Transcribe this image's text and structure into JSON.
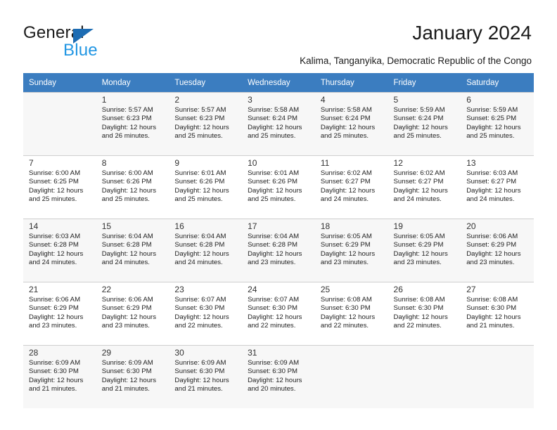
{
  "brand": {
    "name_dark": "General",
    "name_light": "Blue",
    "triangle_color": "#1d6cb3",
    "blue_color": "#2196e3"
  },
  "header": {
    "title": "January 2024",
    "subtitle": "Kalima, Tanganyika, Democratic Republic of the Congo"
  },
  "theme": {
    "header_bg": "#3b7dc0",
    "header_text": "#ffffff",
    "row_shade": "#f7f7f7",
    "grid_line": "#cfcfcf"
  },
  "calendar": {
    "weekday_headers": [
      "Sunday",
      "Monday",
      "Tuesday",
      "Wednesday",
      "Thursday",
      "Friday",
      "Saturday"
    ],
    "weeks": [
      [
        {
          "day": "",
          "sunrise": "",
          "sunset": "",
          "daylight_1": "",
          "daylight_2": ""
        },
        {
          "day": "1",
          "sunrise": "Sunrise: 5:57 AM",
          "sunset": "Sunset: 6:23 PM",
          "daylight_1": "Daylight: 12 hours",
          "daylight_2": "and 26 minutes."
        },
        {
          "day": "2",
          "sunrise": "Sunrise: 5:57 AM",
          "sunset": "Sunset: 6:23 PM",
          "daylight_1": "Daylight: 12 hours",
          "daylight_2": "and 25 minutes."
        },
        {
          "day": "3",
          "sunrise": "Sunrise: 5:58 AM",
          "sunset": "Sunset: 6:24 PM",
          "daylight_1": "Daylight: 12 hours",
          "daylight_2": "and 25 minutes."
        },
        {
          "day": "4",
          "sunrise": "Sunrise: 5:58 AM",
          "sunset": "Sunset: 6:24 PM",
          "daylight_1": "Daylight: 12 hours",
          "daylight_2": "and 25 minutes."
        },
        {
          "day": "5",
          "sunrise": "Sunrise: 5:59 AM",
          "sunset": "Sunset: 6:24 PM",
          "daylight_1": "Daylight: 12 hours",
          "daylight_2": "and 25 minutes."
        },
        {
          "day": "6",
          "sunrise": "Sunrise: 5:59 AM",
          "sunset": "Sunset: 6:25 PM",
          "daylight_1": "Daylight: 12 hours",
          "daylight_2": "and 25 minutes."
        }
      ],
      [
        {
          "day": "7",
          "sunrise": "Sunrise: 6:00 AM",
          "sunset": "Sunset: 6:25 PM",
          "daylight_1": "Daylight: 12 hours",
          "daylight_2": "and 25 minutes."
        },
        {
          "day": "8",
          "sunrise": "Sunrise: 6:00 AM",
          "sunset": "Sunset: 6:26 PM",
          "daylight_1": "Daylight: 12 hours",
          "daylight_2": "and 25 minutes."
        },
        {
          "day": "9",
          "sunrise": "Sunrise: 6:01 AM",
          "sunset": "Sunset: 6:26 PM",
          "daylight_1": "Daylight: 12 hours",
          "daylight_2": "and 25 minutes."
        },
        {
          "day": "10",
          "sunrise": "Sunrise: 6:01 AM",
          "sunset": "Sunset: 6:26 PM",
          "daylight_1": "Daylight: 12 hours",
          "daylight_2": "and 25 minutes."
        },
        {
          "day": "11",
          "sunrise": "Sunrise: 6:02 AM",
          "sunset": "Sunset: 6:27 PM",
          "daylight_1": "Daylight: 12 hours",
          "daylight_2": "and 24 minutes."
        },
        {
          "day": "12",
          "sunrise": "Sunrise: 6:02 AM",
          "sunset": "Sunset: 6:27 PM",
          "daylight_1": "Daylight: 12 hours",
          "daylight_2": "and 24 minutes."
        },
        {
          "day": "13",
          "sunrise": "Sunrise: 6:03 AM",
          "sunset": "Sunset: 6:27 PM",
          "daylight_1": "Daylight: 12 hours",
          "daylight_2": "and 24 minutes."
        }
      ],
      [
        {
          "day": "14",
          "sunrise": "Sunrise: 6:03 AM",
          "sunset": "Sunset: 6:28 PM",
          "daylight_1": "Daylight: 12 hours",
          "daylight_2": "and 24 minutes."
        },
        {
          "day": "15",
          "sunrise": "Sunrise: 6:04 AM",
          "sunset": "Sunset: 6:28 PM",
          "daylight_1": "Daylight: 12 hours",
          "daylight_2": "and 24 minutes."
        },
        {
          "day": "16",
          "sunrise": "Sunrise: 6:04 AM",
          "sunset": "Sunset: 6:28 PM",
          "daylight_1": "Daylight: 12 hours",
          "daylight_2": "and 24 minutes."
        },
        {
          "day": "17",
          "sunrise": "Sunrise: 6:04 AM",
          "sunset": "Sunset: 6:28 PM",
          "daylight_1": "Daylight: 12 hours",
          "daylight_2": "and 23 minutes."
        },
        {
          "day": "18",
          "sunrise": "Sunrise: 6:05 AM",
          "sunset": "Sunset: 6:29 PM",
          "daylight_1": "Daylight: 12 hours",
          "daylight_2": "and 23 minutes."
        },
        {
          "day": "19",
          "sunrise": "Sunrise: 6:05 AM",
          "sunset": "Sunset: 6:29 PM",
          "daylight_1": "Daylight: 12 hours",
          "daylight_2": "and 23 minutes."
        },
        {
          "day": "20",
          "sunrise": "Sunrise: 6:06 AM",
          "sunset": "Sunset: 6:29 PM",
          "daylight_1": "Daylight: 12 hours",
          "daylight_2": "and 23 minutes."
        }
      ],
      [
        {
          "day": "21",
          "sunrise": "Sunrise: 6:06 AM",
          "sunset": "Sunset: 6:29 PM",
          "daylight_1": "Daylight: 12 hours",
          "daylight_2": "and 23 minutes."
        },
        {
          "day": "22",
          "sunrise": "Sunrise: 6:06 AM",
          "sunset": "Sunset: 6:29 PM",
          "daylight_1": "Daylight: 12 hours",
          "daylight_2": "and 23 minutes."
        },
        {
          "day": "23",
          "sunrise": "Sunrise: 6:07 AM",
          "sunset": "Sunset: 6:30 PM",
          "daylight_1": "Daylight: 12 hours",
          "daylight_2": "and 22 minutes."
        },
        {
          "day": "24",
          "sunrise": "Sunrise: 6:07 AM",
          "sunset": "Sunset: 6:30 PM",
          "daylight_1": "Daylight: 12 hours",
          "daylight_2": "and 22 minutes."
        },
        {
          "day": "25",
          "sunrise": "Sunrise: 6:08 AM",
          "sunset": "Sunset: 6:30 PM",
          "daylight_1": "Daylight: 12 hours",
          "daylight_2": "and 22 minutes."
        },
        {
          "day": "26",
          "sunrise": "Sunrise: 6:08 AM",
          "sunset": "Sunset: 6:30 PM",
          "daylight_1": "Daylight: 12 hours",
          "daylight_2": "and 22 minutes."
        },
        {
          "day": "27",
          "sunrise": "Sunrise: 6:08 AM",
          "sunset": "Sunset: 6:30 PM",
          "daylight_1": "Daylight: 12 hours",
          "daylight_2": "and 21 minutes."
        }
      ],
      [
        {
          "day": "28",
          "sunrise": "Sunrise: 6:09 AM",
          "sunset": "Sunset: 6:30 PM",
          "daylight_1": "Daylight: 12 hours",
          "daylight_2": "and 21 minutes."
        },
        {
          "day": "29",
          "sunrise": "Sunrise: 6:09 AM",
          "sunset": "Sunset: 6:30 PM",
          "daylight_1": "Daylight: 12 hours",
          "daylight_2": "and 21 minutes."
        },
        {
          "day": "30",
          "sunrise": "Sunrise: 6:09 AM",
          "sunset": "Sunset: 6:30 PM",
          "daylight_1": "Daylight: 12 hours",
          "daylight_2": "and 21 minutes."
        },
        {
          "day": "31",
          "sunrise": "Sunrise: 6:09 AM",
          "sunset": "Sunset: 6:30 PM",
          "daylight_1": "Daylight: 12 hours",
          "daylight_2": "and 20 minutes."
        },
        {
          "day": "",
          "sunrise": "",
          "sunset": "",
          "daylight_1": "",
          "daylight_2": ""
        },
        {
          "day": "",
          "sunrise": "",
          "sunset": "",
          "daylight_1": "",
          "daylight_2": ""
        },
        {
          "day": "",
          "sunrise": "",
          "sunset": "",
          "daylight_1": "",
          "daylight_2": ""
        }
      ]
    ]
  }
}
